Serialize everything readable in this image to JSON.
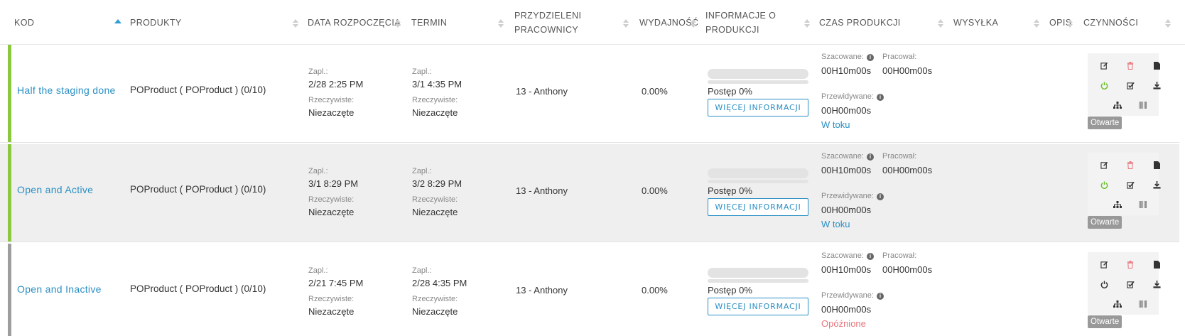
{
  "columns": {
    "kod": "KOD",
    "produkty": "PRODUKTY",
    "data_rozpoczecia": "DATA ROZPOCZĘCIA",
    "termin": "TERMIN",
    "przydzieleni_1": "PRZYDZIELENI",
    "przydzieleni_2": "PRACOWNICY",
    "wydajnosc": "WYDAJNOŚĆ",
    "informacje_1": "INFORMACJE O",
    "informacje_2": "PRODUKCJI",
    "czas_produkcji": "CZAS PRODUKCJI",
    "wysylka": "WYSYŁKA",
    "opis": "OPIS",
    "czynnosci": "CZYNNOŚCI"
  },
  "labels": {
    "zapl": "Zapl.:",
    "rzeczywiste": "Rzeczywiste:",
    "postep": "Postęp 0%",
    "more_info": "WIĘCEJ INFORMACJI",
    "szacowane": "Szacowane:",
    "pracowal": "Pracował:",
    "przewidywane": "Przewidywane:"
  },
  "colors": {
    "accent": "#2a8fc4",
    "active_bar": "#8dc63f",
    "inactive_bar": "#9e9e9e",
    "late": "#e8737a",
    "power_on": "#6cbf2b"
  },
  "rows": [
    {
      "code": "Half the staging done",
      "product": "POProduct ( POProduct ) (0/10)",
      "start_planned": "2/28   2:25 PM",
      "start_actual": "Niezaczęte",
      "due_planned": "3/1   4:35 PM",
      "due_actual": "Niezaczęte",
      "workers": "13 - Anthony",
      "efficiency": "0.00%",
      "progress": 0,
      "estimated": "00H10m00s",
      "worked": "00H00m00s",
      "predicted": "00H00m00s",
      "status": "W toku",
      "state_badge": "Otwarte"
    },
    {
      "code": "Open and Active",
      "product": "POProduct ( POProduct ) (0/10)",
      "start_planned": "3/1   8:29 PM",
      "start_actual": "Niezaczęte",
      "due_planned": "3/2   8:29 PM",
      "due_actual": "Niezaczęte",
      "workers": "13 - Anthony",
      "efficiency": "0.00%",
      "progress": 0,
      "estimated": "00H10m00s",
      "worked": "00H00m00s",
      "predicted": "00H00m00s",
      "status": "W toku",
      "state_badge": "Otwarte"
    },
    {
      "code": "Open and Inactive",
      "product": "POProduct ( POProduct ) (0/10)",
      "start_planned": "2/21   7:45 PM",
      "start_actual": "Niezaczęte",
      "due_planned": "2/28   4:35 PM",
      "due_actual": "Niezaczęte",
      "workers": "13 - Anthony",
      "efficiency": "0.00%",
      "progress": 0,
      "estimated": "00H10m00s",
      "worked": "00H00m00s",
      "predicted": "00H00m00s",
      "status": "Opóźnione",
      "state_badge": "Otwarte"
    }
  ]
}
